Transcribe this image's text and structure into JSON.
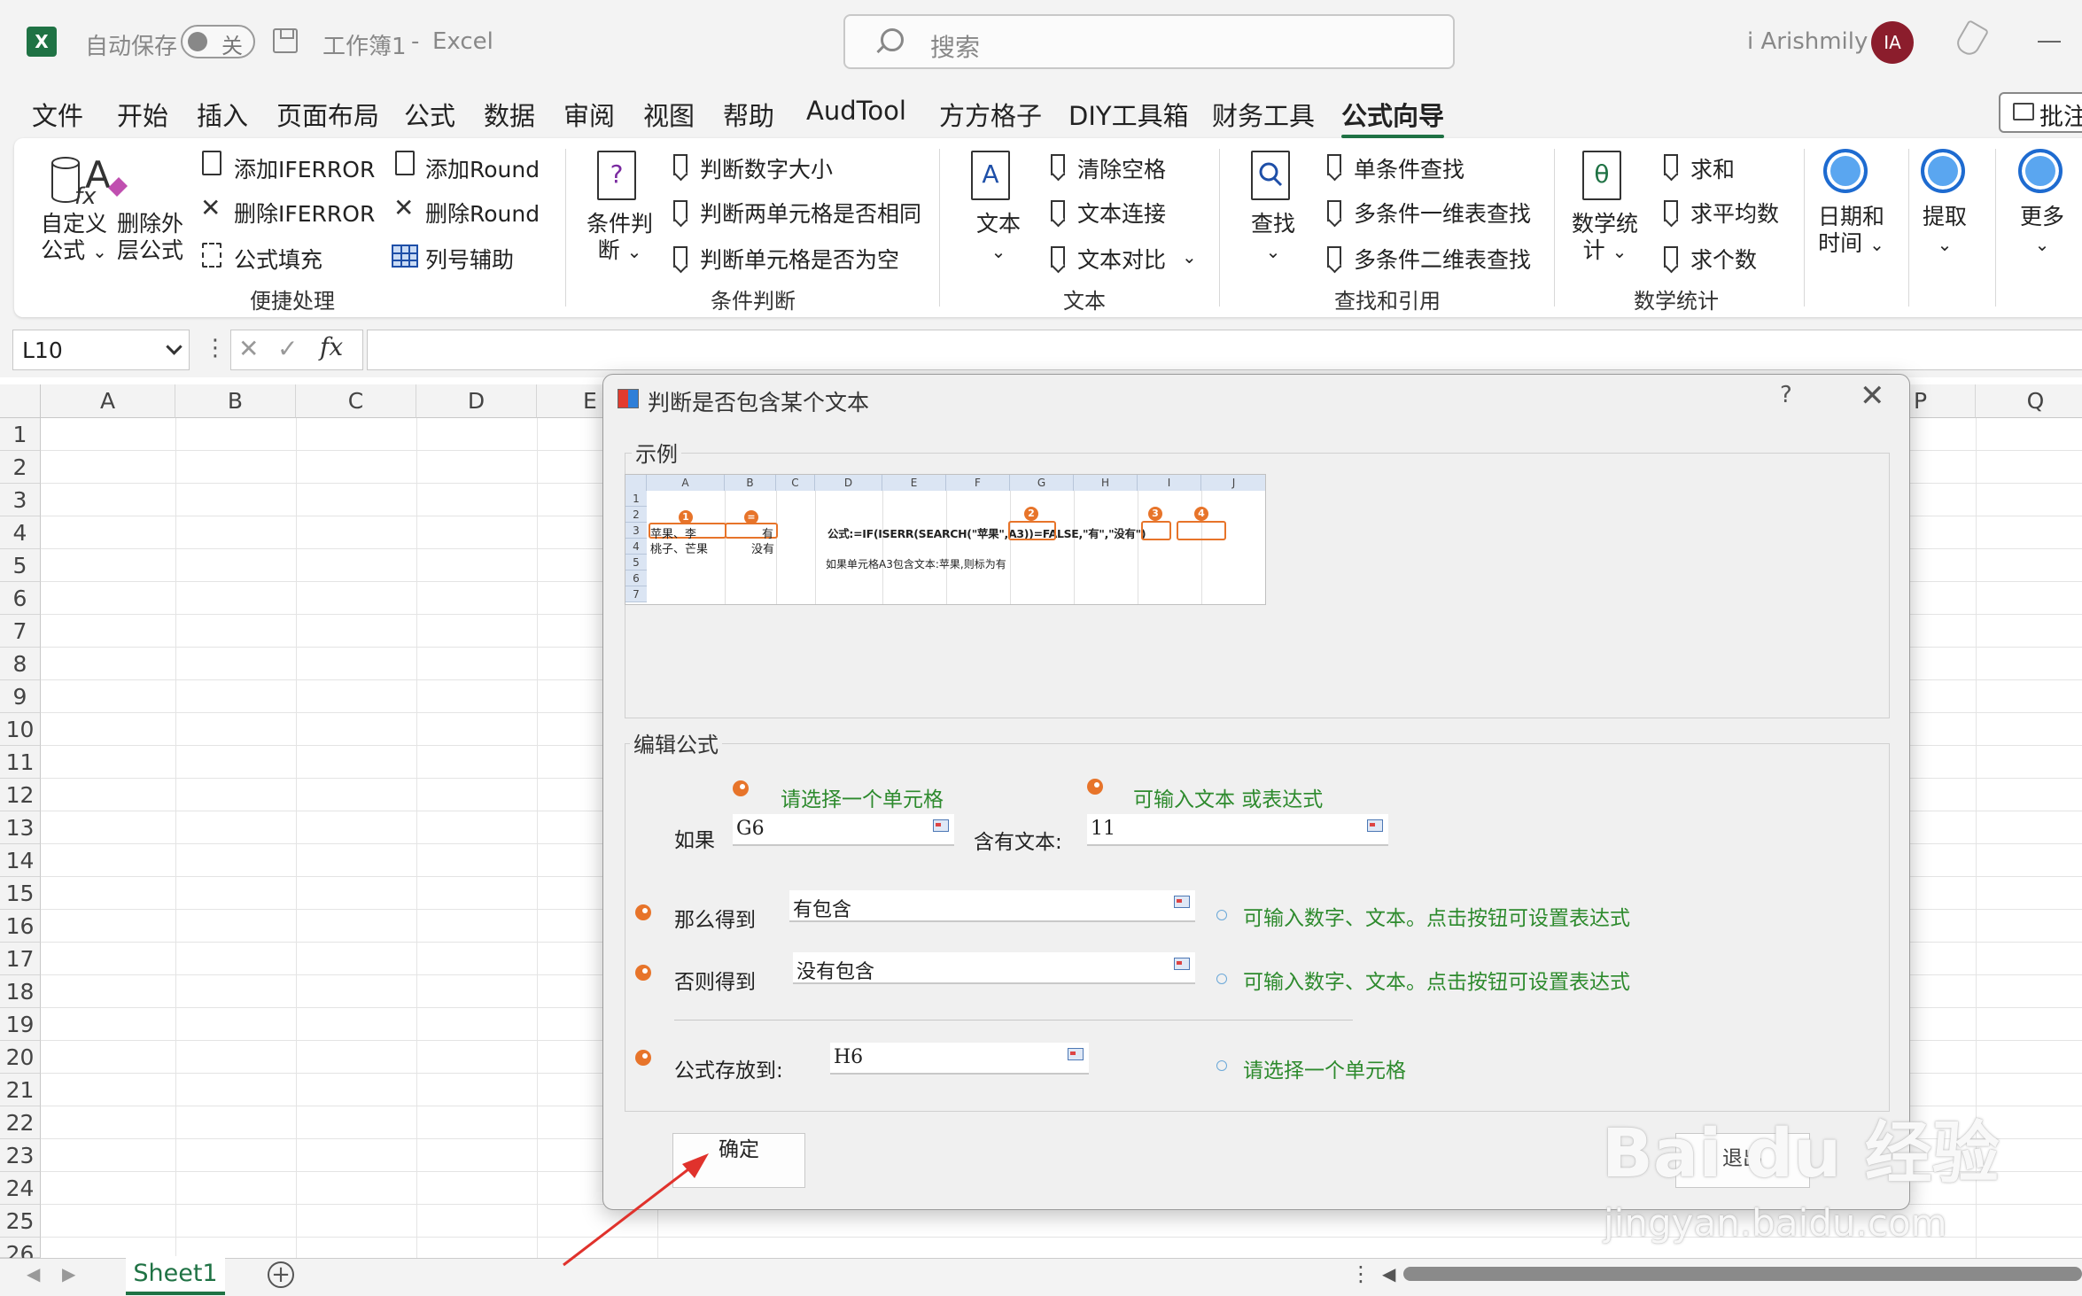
{
  "titlebar": {
    "autosave_label": "自动保存",
    "toggle_state": "关",
    "workbook": "工作簿1",
    "separator": "-",
    "app": "Excel",
    "search_placeholder": "搜索",
    "user_name": "i Arishmily",
    "avatar_initials": "IA"
  },
  "menu": {
    "tabs": [
      "文件",
      "开始",
      "插入",
      "页面布局",
      "公式",
      "数据",
      "审阅",
      "视图",
      "帮助",
      "AudTool",
      "方方格子",
      "DIY工具箱",
      "财务工具",
      "公式向导"
    ],
    "active": "公式向导",
    "comment_button": "批注"
  },
  "ribbon": {
    "quick": {
      "custom_formula": [
        "自定义",
        "公式"
      ],
      "delete_outer": [
        "删除外",
        "层公式"
      ],
      "add_iferror": "添加IFERROR",
      "del_iferror": "删除IFERROR",
      "fill_formula": "公式填充",
      "add_round": "添加Round",
      "del_round": "删除Round",
      "col_helper": "列号辅助",
      "group": "便捷处理"
    },
    "cond": {
      "big_button": [
        "条件判",
        "断"
      ],
      "items": [
        "判断数字大小",
        "判断两单元格是否相同",
        "判断单元格是否为空"
      ],
      "group": "条件判断"
    },
    "text": {
      "big_button": "文本",
      "items": [
        "清除空格",
        "文本连接",
        "文本对比"
      ],
      "group": "文本"
    },
    "lookup": {
      "big_button": "查找",
      "items": [
        "单条件查找",
        "多条件一维表查找",
        "多条件二维表查找"
      ],
      "group": "查找和引用"
    },
    "math": {
      "big_button": [
        "数学统",
        "计"
      ],
      "items": [
        "求和",
        "求平均数",
        "求个数"
      ],
      "group": "数学统计"
    },
    "date": [
      "日期和",
      "时间"
    ],
    "extract": "提取",
    "more": "更多",
    "icon_letters": {
      "text": "A",
      "math": "θ",
      "cond": "?"
    }
  },
  "formula_bar": {
    "name_box": "L10",
    "fx": "fx"
  },
  "sheet": {
    "columns": [
      "A",
      "B",
      "C",
      "D",
      "E",
      "P",
      "Q"
    ],
    "rows": [
      "1",
      "2",
      "3",
      "4",
      "5",
      "6",
      "7",
      "8",
      "9",
      "10",
      "11",
      "12",
      "13",
      "14",
      "15",
      "16",
      "17",
      "18",
      "19",
      "20",
      "21",
      "22",
      "23",
      "24",
      "25",
      "26"
    ],
    "tab": "Sheet1"
  },
  "dialog": {
    "title": "判断是否包含某个文本",
    "help": "?",
    "example_legend": "示例",
    "edit_legend": "编辑公式",
    "hint_select_cell": "请选择一个单元格",
    "hint_text_or_expr": "可输入文本 或表达式",
    "if_label": "如果",
    "if_value": "G6",
    "contains_label": "含有文本:",
    "contains_value": "11",
    "then_label": "那么得到",
    "then_value": "有包含",
    "then_hint": "可输入数字、文本。点击按钮可设置表达式",
    "else_label": "否则得到",
    "else_value": "没有包含",
    "else_hint": "可输入数字、文本。点击按钮可设置表达式",
    "store_label": "公式存放到:",
    "store_value": "H6",
    "store_hint": "请选择一个单元格",
    "ok_button": "确定",
    "exit_button": "退出"
  },
  "example": {
    "cols": [
      "A",
      "B",
      "C",
      "D",
      "E",
      "F",
      "G",
      "H",
      "I",
      "J"
    ],
    "rows": [
      "1",
      "2",
      "3",
      "4",
      "5",
      "6",
      "7"
    ],
    "a3": "苹果、李",
    "b3": "有",
    "a4": "桃子、芒果",
    "b4": "没有",
    "formula": "公式:=IF(ISERR(SEARCH(\"苹果\",A3))=FALSE,\"有\",\"没有\")",
    "note": "如果单元格A3包含文本:苹果,则标为有",
    "markers": [
      "1",
      "=",
      "2",
      "3",
      "4"
    ]
  },
  "watermark": {
    "brand": "Bai du 经验",
    "url": "jingyan.baidu.com"
  }
}
